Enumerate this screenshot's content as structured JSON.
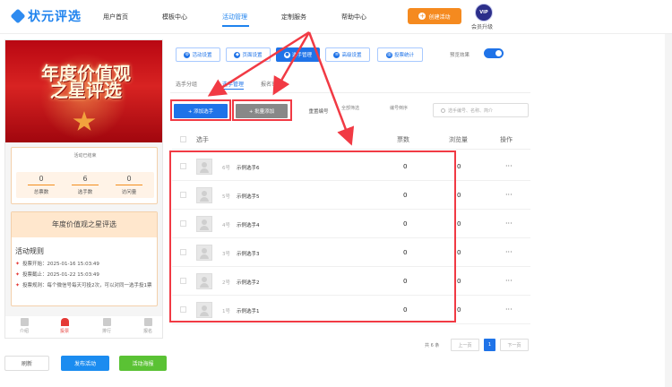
{
  "app": {
    "logo_text": "状元评选"
  },
  "nav": {
    "items": [
      "用户首页",
      "模板中心",
      "活动管理",
      "定制服务",
      "帮助中心"
    ],
    "create_label": "创建活动",
    "vip_badge": "VIP",
    "vip_label": "会员升级"
  },
  "preview": {
    "poster_title_1": "年度价值观",
    "poster_title_2": "之星评选",
    "status": "活动已结束",
    "stats": [
      {
        "value": "0",
        "label": "总票数"
      },
      {
        "value": "6",
        "label": "选手数"
      },
      {
        "value": "0",
        "label": "访问量"
      }
    ],
    "rules_title": "年度价值观之星评选",
    "rules_heading": "活动规则",
    "rules": [
      "投票开始：2025-01-16 15:03:49",
      "投票截止：2025-01-22 15:03:49",
      "投票规则：每个微信号每天可投2次，可以对同一选手投1票"
    ],
    "tabs": [
      "介绍",
      "投票",
      "排行",
      "报名"
    ],
    "active_tab": "投票"
  },
  "bottom_actions": {
    "refresh": "刷新",
    "publish": "发布活动",
    "poster": "活动海报"
  },
  "features": {
    "buttons": [
      "活动设置",
      "页面设置",
      "选手管理",
      "高级设置",
      "投票统计"
    ],
    "preview_label": "预览效果",
    "preview_toggle": true
  },
  "subtabs": [
    "选手分组",
    "选手管理",
    "报名审核"
  ],
  "toolbar": {
    "add_player": "+ 添加选手",
    "batch_add": "+ 批量添加",
    "renumber": "重置编号",
    "filter": "全部筛选",
    "sort": "编号倒序",
    "search_placeholder": "选手编号、名称、简介"
  },
  "table": {
    "headers": [
      "选手",
      "票数",
      "浏览量",
      "操作"
    ],
    "rows": [
      {
        "number": "6号",
        "name": "示例选手6",
        "votes": "0",
        "views": "0",
        "ops": "···"
      },
      {
        "number": "5号",
        "name": "示例选手5",
        "votes": "0",
        "views": "0",
        "ops": "···"
      },
      {
        "number": "4号",
        "name": "示例选手4",
        "votes": "0",
        "views": "0",
        "ops": "···"
      },
      {
        "number": "3号",
        "name": "示例选手3",
        "votes": "0",
        "views": "0",
        "ops": "···"
      },
      {
        "number": "2号",
        "name": "示例选手2",
        "votes": "0",
        "views": "0",
        "ops": "···"
      },
      {
        "number": "1号",
        "name": "示例选手1",
        "votes": "0",
        "views": "0",
        "ops": "···"
      }
    ]
  },
  "pagination": {
    "total": "共 6 条",
    "prev": "上一页",
    "current": "1",
    "next": "下一页"
  },
  "colors": {
    "brand_blue": "#1f73e8",
    "orange": "#f58a1f",
    "red_annotation": "#f13a44",
    "green": "#5ac234"
  }
}
